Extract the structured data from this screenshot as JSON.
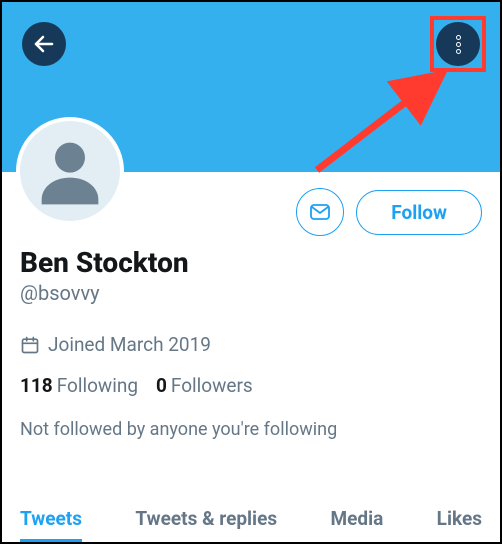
{
  "colors": {
    "banner": "#34b0ee",
    "iconCircle": "#16395a",
    "accent": "#1da1f2",
    "muted": "#657786",
    "highlight": "#ff3b30"
  },
  "header": {
    "back_icon": "arrow-left",
    "more_icon": "more-vertical"
  },
  "actions": {
    "message_icon": "envelope",
    "follow_label": "Follow"
  },
  "profile": {
    "display_name": "Ben Stockton",
    "handle": "@bsovvy",
    "joined_label": "Joined March 2019",
    "following_count": "118",
    "following_label": "Following",
    "followers_count": "0",
    "followers_label": "Followers",
    "note": "Not followed by anyone you're following"
  },
  "tabs": [
    {
      "label": "Tweets",
      "active": true
    },
    {
      "label": "Tweets & replies",
      "active": false
    },
    {
      "label": "Media",
      "active": false
    },
    {
      "label": "Likes",
      "active": false
    }
  ]
}
